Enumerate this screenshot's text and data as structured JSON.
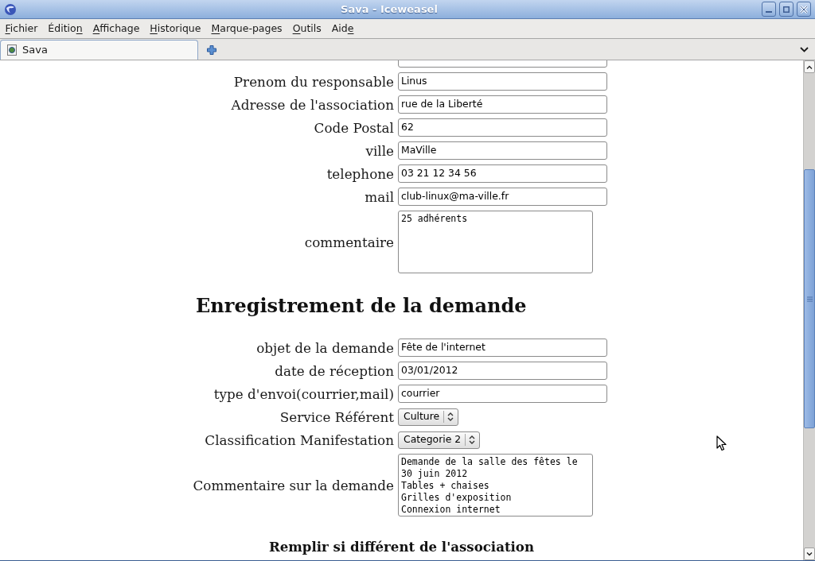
{
  "window": {
    "title": "Sava - Iceweasel"
  },
  "menu_bar": [
    {
      "access_key": "F",
      "text_after": "ichier"
    },
    {
      "text_before": "Éditio",
      "access_key": "n"
    },
    {
      "access_key": "A",
      "text_after": "ffichage"
    },
    {
      "access_key": "H",
      "text_after": "istorique"
    },
    {
      "access_key": "M",
      "text_after": "arque-pages"
    },
    {
      "access_key": "O",
      "text_after": "utils"
    },
    {
      "text_before": "Aid",
      "access_key": "e"
    }
  ],
  "tabs": [
    {
      "label": "Sava",
      "selected": true
    }
  ],
  "association_fields": [
    {
      "kind": "text"
    },
    {
      "kind": "text",
      "label": "Prenom du responsable",
      "value": "Linus"
    },
    {
      "kind": "text",
      "label": "Adresse de l'association",
      "value": "rue de la Liberté"
    },
    {
      "kind": "text",
      "label": "Code Postal",
      "value": "62"
    },
    {
      "kind": "text",
      "label": "ville",
      "value": "MaVille"
    },
    {
      "kind": "text",
      "label": "telephone",
      "value": "03 21 12 34 56"
    },
    {
      "kind": "text",
      "label": "mail",
      "value": "club-linux@ma-ville.fr"
    },
    {
      "kind": "textarea",
      "label": "commentaire",
      "value": "25 adhérents"
    }
  ],
  "request_heading": "Enregistrement de la demande",
  "request_fields": [
    {
      "kind": "text",
      "label": "objet de la demande",
      "value": "Fête de l'internet"
    },
    {
      "kind": "text",
      "label": "date de réception",
      "value": "03/01/2012"
    },
    {
      "kind": "text",
      "label": "type d'envoi(courrier,mail)",
      "value": "courrier"
    },
    {
      "kind": "select",
      "label": "Service Référent",
      "value": "Culture"
    },
    {
      "kind": "select",
      "label": "Classification Manifestation",
      "value": "Categorie 2"
    },
    {
      "kind": "textarea",
      "label": "Commentaire sur la demande",
      "value": "Demande de la salle des fêtes le 30 juin 2012\nTables + chaises\nGrilles d'exposition\nConnexion internet"
    }
  ],
  "next_heading": "Remplir si différent de l'association"
}
